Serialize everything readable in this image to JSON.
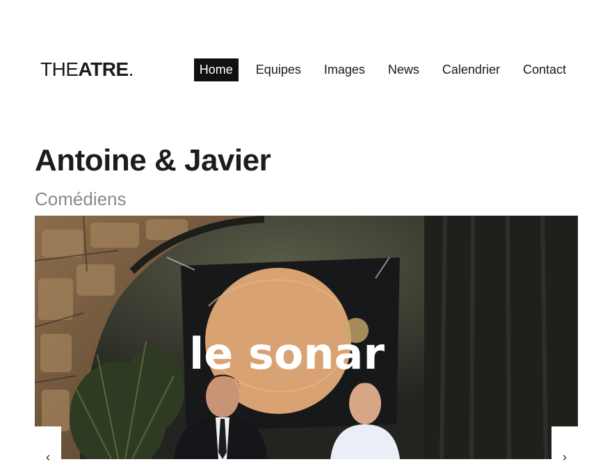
{
  "header": {
    "logo_light": "THE",
    "logo_bold": "ATRE",
    "logo_dot": ".",
    "nav": [
      {
        "label": "Home",
        "active": true
      },
      {
        "label": "Equipes",
        "active": false
      },
      {
        "label": "Images",
        "active": false
      },
      {
        "label": "News",
        "active": false
      },
      {
        "label": "Calendrier",
        "active": false
      },
      {
        "label": "Contact",
        "active": false
      }
    ]
  },
  "main": {
    "title": "Antoine & Javier",
    "subtitle": "Comédiens"
  },
  "slider": {
    "banner_text": "le sonar",
    "prev_icon": "‹",
    "next_icon": "›"
  },
  "colors": {
    "text": "#1a1a1a",
    "nav_active_bg": "#111111",
    "subtitle": "#8a8a8a",
    "banner_orange": "#d9a272"
  }
}
